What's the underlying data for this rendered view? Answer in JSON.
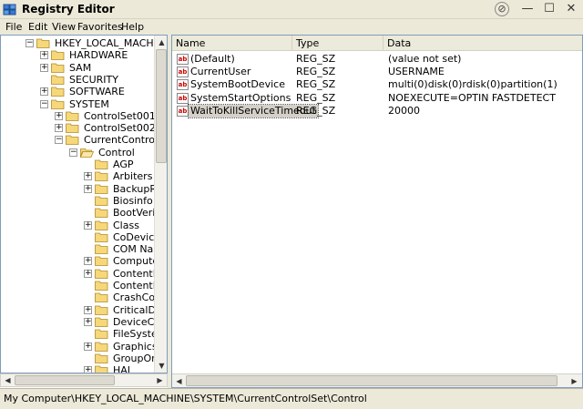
{
  "window": {
    "title": "Registry Editor",
    "pin_glyph": "⊘",
    "min_glyph": "—",
    "max_glyph": "☐",
    "close_glyph": "✕"
  },
  "menu": [
    "File",
    "Edit",
    "View",
    "Favorites",
    "Help"
  ],
  "tree": [
    {
      "label": "HKEY_LOCAL_MACHINE",
      "exp": "−",
      "depth": 0
    },
    {
      "label": "HARDWARE",
      "exp": "+",
      "depth": 1
    },
    {
      "label": "SAM",
      "exp": "+",
      "depth": 1
    },
    {
      "label": "SECURITY",
      "exp": "",
      "depth": 1
    },
    {
      "label": "SOFTWARE",
      "exp": "+",
      "depth": 1
    },
    {
      "label": "SYSTEM",
      "exp": "−",
      "depth": 1
    },
    {
      "label": "ControlSet001",
      "exp": "+",
      "depth": 2
    },
    {
      "label": "ControlSet002",
      "exp": "+",
      "depth": 2
    },
    {
      "label": "CurrentControlSet",
      "exp": "−",
      "depth": 2
    },
    {
      "label": "Control",
      "exp": "−",
      "depth": 3,
      "open": true
    },
    {
      "label": "AGP",
      "exp": "",
      "depth": 4
    },
    {
      "label": "Arbiters",
      "exp": "+",
      "depth": 4
    },
    {
      "label": "BackupResto",
      "exp": "+",
      "depth": 4
    },
    {
      "label": "Biosinfo",
      "exp": "",
      "depth": 4
    },
    {
      "label": "BootVerificat",
      "exp": "",
      "depth": 4
    },
    {
      "label": "Class",
      "exp": "+",
      "depth": 4
    },
    {
      "label": "CoDeviceIns",
      "exp": "",
      "depth": 4
    },
    {
      "label": "COM Name A",
      "exp": "",
      "depth": 4
    },
    {
      "label": "ComputerNa",
      "exp": "+",
      "depth": 4
    },
    {
      "label": "ContentInde",
      "exp": "+",
      "depth": 4
    },
    {
      "label": "ContentInde",
      "exp": "",
      "depth": 4
    },
    {
      "label": "CrashContro",
      "exp": "",
      "depth": 4
    },
    {
      "label": "CriticalDevic",
      "exp": "+",
      "depth": 4
    },
    {
      "label": "DeviceClasse",
      "exp": "+",
      "depth": 4
    },
    {
      "label": "FileSystem",
      "exp": "",
      "depth": 4
    },
    {
      "label": "GraphicsDriv",
      "exp": "+",
      "depth": 4
    },
    {
      "label": "GroupOrderl",
      "exp": "",
      "depth": 4
    },
    {
      "label": "HAL",
      "exp": "+",
      "depth": 4
    }
  ],
  "columns": {
    "name": "Name",
    "type": "Type",
    "data": "Data"
  },
  "values": [
    {
      "icon": "ab",
      "name": "(Default)",
      "type": "REG_SZ",
      "data": "(value not set)"
    },
    {
      "icon": "ab",
      "name": "CurrentUser",
      "type": "REG_SZ",
      "data": "USERNAME"
    },
    {
      "icon": "ab",
      "name": "SystemBootDevice",
      "type": "REG_SZ",
      "data": "multi(0)disk(0)rdisk(0)partition(1)"
    },
    {
      "icon": "ab",
      "name": "SystemStartOptions",
      "type": "REG_SZ",
      "data": "NOEXECUTE=OPTIN  FASTDETECT"
    },
    {
      "icon": "ab",
      "name": "WaitToKillServiceTimeout",
      "type": "REG_SZ",
      "data": "20000",
      "selected": true
    }
  ],
  "status": "My Computer\\HKEY_LOCAL_MACHINE\\SYSTEM\\CurrentControlSet\\Control",
  "colors": {
    "folder": "#f6d87a",
    "folder_edge": "#b08a2a",
    "border": "#7f9db9",
    "chrome": "#ece9d8"
  }
}
